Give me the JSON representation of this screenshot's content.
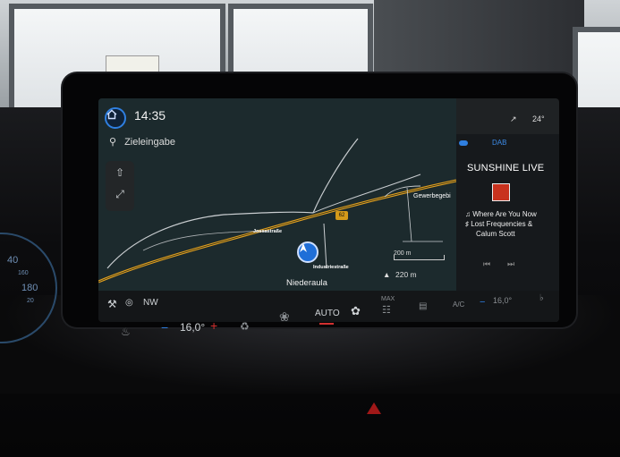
{
  "header": {
    "time": "14:35",
    "temperature": "24°"
  },
  "search": {
    "label": "Zieleingabe"
  },
  "map": {
    "streets": [
      "Jossastraße",
      "Industriestraße",
      "Gewerbegebi"
    ],
    "road_number": "62",
    "scale": "200 m",
    "elevation": "220 m",
    "place": "Niederaula",
    "heading": "NW"
  },
  "radio": {
    "source": "DAB",
    "station": "SUNSHINE LIVE",
    "track_title": "Where Are You Now",
    "track_artist_line1": "Lost Frequencies &",
    "track_artist_line2": "Calum Scott"
  },
  "climate": {
    "left_temp": "16,0°",
    "mode": "AUTO",
    "max_label": "MAX",
    "ac_label": "A/C",
    "right_temp": "16,0°"
  },
  "gauges": {
    "marks": [
      "40",
      "160",
      "180",
      "20"
    ]
  },
  "colors": {
    "accent": "#2f7fe0",
    "road": "#e0a020",
    "hazard": "#a01818"
  }
}
